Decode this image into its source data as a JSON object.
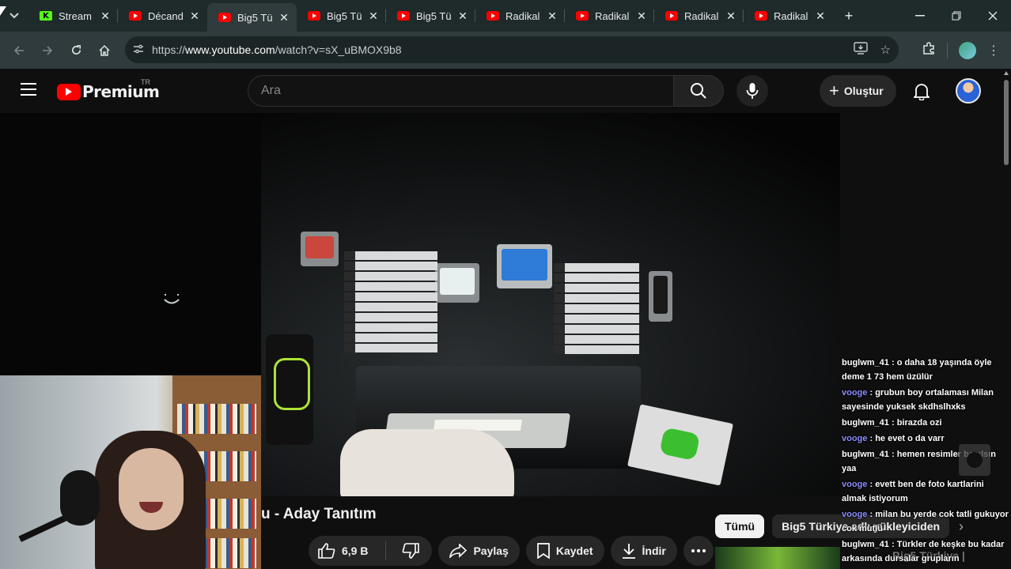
{
  "browser": {
    "tabs": [
      {
        "label": "Stream",
        "favicon": "kick-icon",
        "active": false
      },
      {
        "label": "Décand",
        "favicon": "youtube-icon",
        "active": false
      },
      {
        "label": "Big5 Tü",
        "favicon": "youtube-icon",
        "active": true
      },
      {
        "label": "Big5 Tü",
        "favicon": "youtube-icon",
        "active": false
      },
      {
        "label": "Big5 Tü",
        "favicon": "youtube-icon",
        "active": false
      },
      {
        "label": "Radikal",
        "favicon": "youtube-icon",
        "active": false
      },
      {
        "label": "Radikal",
        "favicon": "youtube-icon",
        "active": false
      },
      {
        "label": "Radikal",
        "favicon": "youtube-icon",
        "active": false
      },
      {
        "label": "Radikal",
        "favicon": "youtube-icon",
        "active": false
      }
    ],
    "url_prefix": "https://",
    "url_host": "www.youtube.com",
    "url_path": "/watch?v=sX_uBMOX9b8"
  },
  "youtube": {
    "brand": "Premium",
    "region": "TR",
    "search_placeholder": "Ara",
    "create_label": "Oluştur"
  },
  "video": {
    "title": "u - Aday Tanıtım",
    "likes": "6,9 B",
    "share_label": "Paylaş",
    "save_label": "Kaydet",
    "download_label": "İndir"
  },
  "chips": [
    "Tümü",
    "Big5 Türkiye adlı yükleyiciden"
  ],
  "recommendation": {
    "title": "Big5 Türkiye |"
  },
  "chat": [
    {
      "user": "buglwm_41",
      "text": ": o daha 18 yaşında öyle deme 1 73 hem üzülür",
      "vip": false
    },
    {
      "user": "vooge",
      "text": ": grubun boy ortalaması Milan sayesinde yuksek skdhslhxks",
      "vip": true
    },
    {
      "user": "buglwm_41",
      "text": ": birazda ozi",
      "vip": false
    },
    {
      "user": "vooge",
      "text": ": he evet o da varr",
      "vip": true
    },
    {
      "user": "buglwm_41",
      "text": ": hemen resimler basılsın yaa",
      "vip": false
    },
    {
      "user": "vooge",
      "text": ": evett ben de foto kartlarini almak istiyorum",
      "vip": true
    },
    {
      "user": "vooge",
      "text": ": milan bu yerde cok tatli gukuyor cok mutlu",
      "vip": true
    },
    {
      "user": "buglwm_41",
      "text": ": Türkler de keşke bu kadar arkasında dursalar grupların",
      "vip": false
    }
  ]
}
